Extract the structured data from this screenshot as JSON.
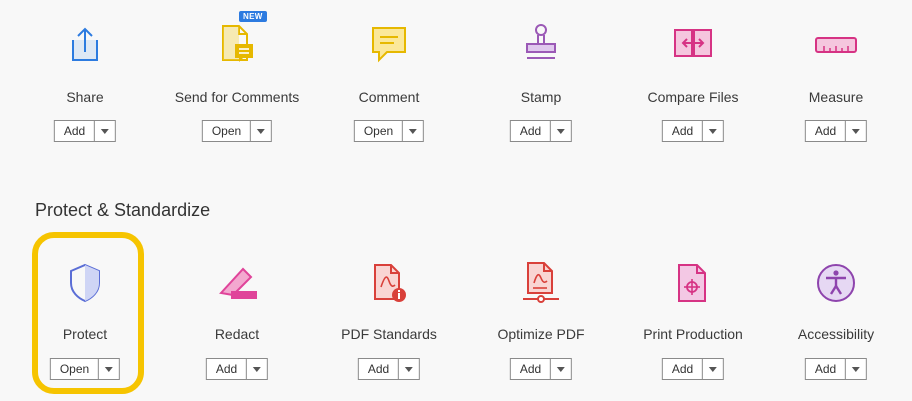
{
  "row1": [
    {
      "label": "Share",
      "button": "Add",
      "icon": "share-icon",
      "badge": ""
    },
    {
      "label": "Send for Comments",
      "button": "Open",
      "icon": "send-for-comments-icon",
      "badge": "NEW"
    },
    {
      "label": "Comment",
      "button": "Open",
      "icon": "comment-icon",
      "badge": ""
    },
    {
      "label": "Stamp",
      "button": "Add",
      "icon": "stamp-icon",
      "badge": ""
    },
    {
      "label": "Compare Files",
      "button": "Add",
      "icon": "compare-files-icon",
      "badge": ""
    },
    {
      "label": "Measure",
      "button": "Add",
      "icon": "measure-icon",
      "badge": ""
    }
  ],
  "section": {
    "title": "Protect & Standardize"
  },
  "row2": [
    {
      "label": "Protect",
      "button": "Open",
      "icon": "protect-icon"
    },
    {
      "label": "Redact",
      "button": "Add",
      "icon": "redact-icon"
    },
    {
      "label": "PDF Standards",
      "button": "Add",
      "icon": "pdf-standards-icon"
    },
    {
      "label": "Optimize PDF",
      "button": "Add",
      "icon": "optimize-pdf-icon"
    },
    {
      "label": "Print Production",
      "button": "Add",
      "icon": "print-production-icon"
    },
    {
      "label": "Accessibility",
      "button": "Add",
      "icon": "accessibility-icon"
    }
  ],
  "colors": {
    "share": "#2d7be0",
    "review": "#e6b800",
    "stamp": "#9b59b6",
    "pink": "#d63384",
    "protect": "#5b6ed6",
    "redact": "#e0449a",
    "pdfred": "#d9403a",
    "highlight": "#f6c400"
  }
}
